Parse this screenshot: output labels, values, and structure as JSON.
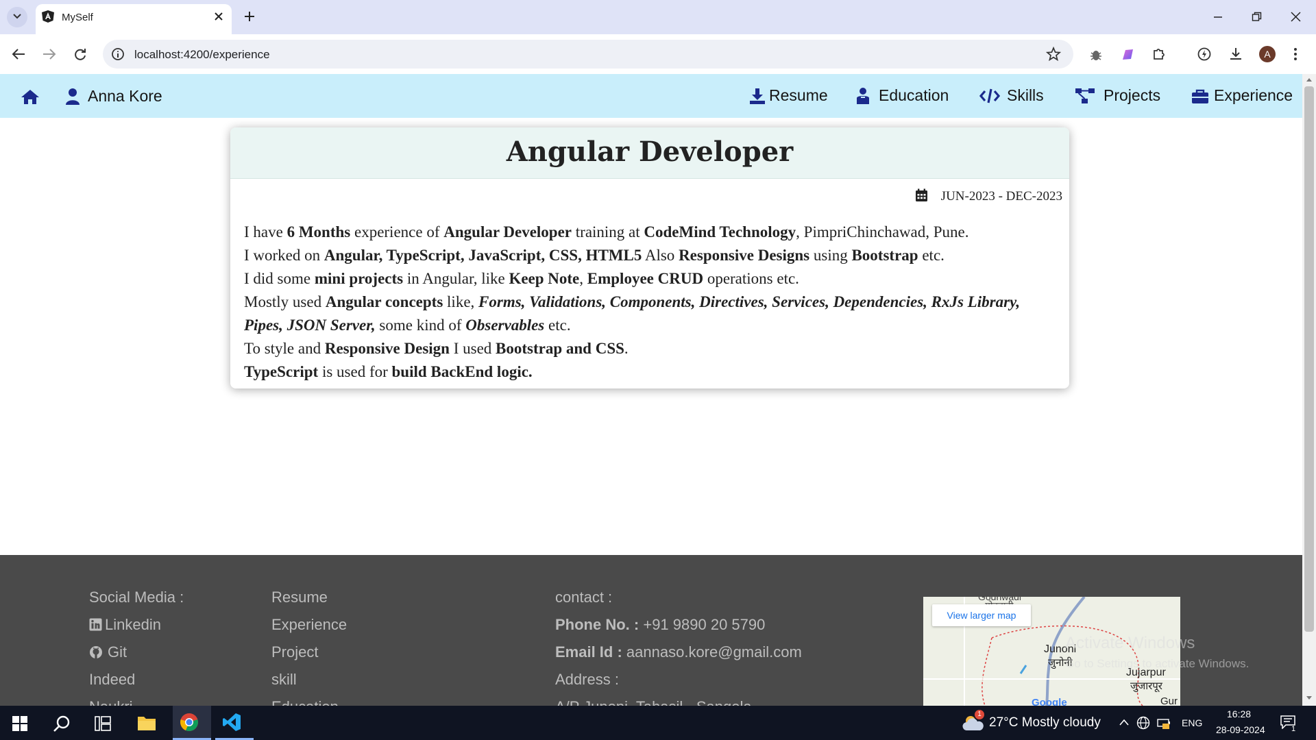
{
  "browser": {
    "tab_title": "MySelf",
    "url": "localhost:4200/experience",
    "profile_initial": "A"
  },
  "navbar": {
    "brand": "Anna Kore",
    "items": [
      {
        "label": "Resume",
        "icon": "download-icon"
      },
      {
        "label": "Education",
        "icon": "teacher-icon"
      },
      {
        "label": "Skills",
        "icon": "code-icon"
      },
      {
        "label": "Projects",
        "icon": "diagram-icon"
      },
      {
        "label": "Experience",
        "icon": "briefcase-icon"
      }
    ]
  },
  "card": {
    "title": "Angular Developer",
    "date": "JUN-2023 - DEC-2023",
    "lines": [
      [
        {
          "t": "I have "
        },
        {
          "t": "6 Months",
          "b": true
        },
        {
          "t": " experience of "
        },
        {
          "t": "Angular Developer",
          "b": true
        },
        {
          "t": " training at "
        },
        {
          "t": "CodeMind Technology",
          "b": true
        },
        {
          "t": ", PimpriChinchawad, Pune."
        }
      ],
      [
        {
          "t": "I worked on "
        },
        {
          "t": "Angular, TypeScript, JavaScript, CSS, HTML5",
          "b": true
        },
        {
          "t": " Also "
        },
        {
          "t": "Responsive Designs",
          "b": true
        },
        {
          "t": " using "
        },
        {
          "t": "Bootstrap",
          "b": true
        },
        {
          "t": " etc."
        }
      ],
      [
        {
          "t": "I did some "
        },
        {
          "t": "mini projects",
          "b": true
        },
        {
          "t": " in Angular, like "
        },
        {
          "t": "Keep Note",
          "b": true
        },
        {
          "t": ", "
        },
        {
          "t": "Employee CRUD",
          "b": true
        },
        {
          "t": " operations etc."
        }
      ],
      [
        {
          "t": "Mostly used "
        },
        {
          "t": "Angular concepts",
          "b": true
        },
        {
          "t": " like, "
        },
        {
          "t": "Forms, Validations, Components, Directives, Services, Dependencies, RxJs Library, Pipes, JSON Server,",
          "b": true,
          "i": true
        },
        {
          "t": " some kind of "
        },
        {
          "t": "Observables",
          "b": true,
          "i": true
        },
        {
          "t": " etc."
        }
      ],
      [
        {
          "t": "To style and "
        },
        {
          "t": "Responsive Design",
          "b": true
        },
        {
          "t": " I used "
        },
        {
          "t": "Bootstrap and CSS",
          "b": true
        },
        {
          "t": "."
        }
      ],
      [
        {
          "t": "TypeScript",
          "b": true
        },
        {
          "t": " is used for "
        },
        {
          "t": "build BackEnd logic.",
          "b": true
        }
      ]
    ]
  },
  "footer": {
    "social_title": "Social Media :",
    "social_links": [
      "Linkedin",
      "Git",
      "Indeed",
      "Naukri"
    ],
    "nav_links": [
      "Resume",
      "Experience",
      "Project",
      "skill",
      "Education"
    ],
    "contact_title": "contact :",
    "phone_label": "Phone No. :",
    "phone": "+91 9890 20 5790",
    "email_label": "Email Id :",
    "email": "aannaso.kore@gmail.com",
    "address_label": "Address :",
    "address": "A/P Junoni, Tahasil - Sangola",
    "map": {
      "button": "View larger map",
      "labels": [
        "Godhwadi",
        "गोडवाडी",
        "Junoni",
        "जुनोनी",
        "Jujarpur",
        "जुजारपूर",
        "Gur",
        "Google"
      ]
    },
    "watermark_title": "Activate Windows",
    "watermark_sub": "Go to Settings to activate Windows."
  },
  "taskbar": {
    "weather_badge": "1",
    "weather": "27°C  Mostly cloudy",
    "lang": "ENG",
    "time": "16:28",
    "date": "28-09-2024",
    "notif_count": "1"
  }
}
